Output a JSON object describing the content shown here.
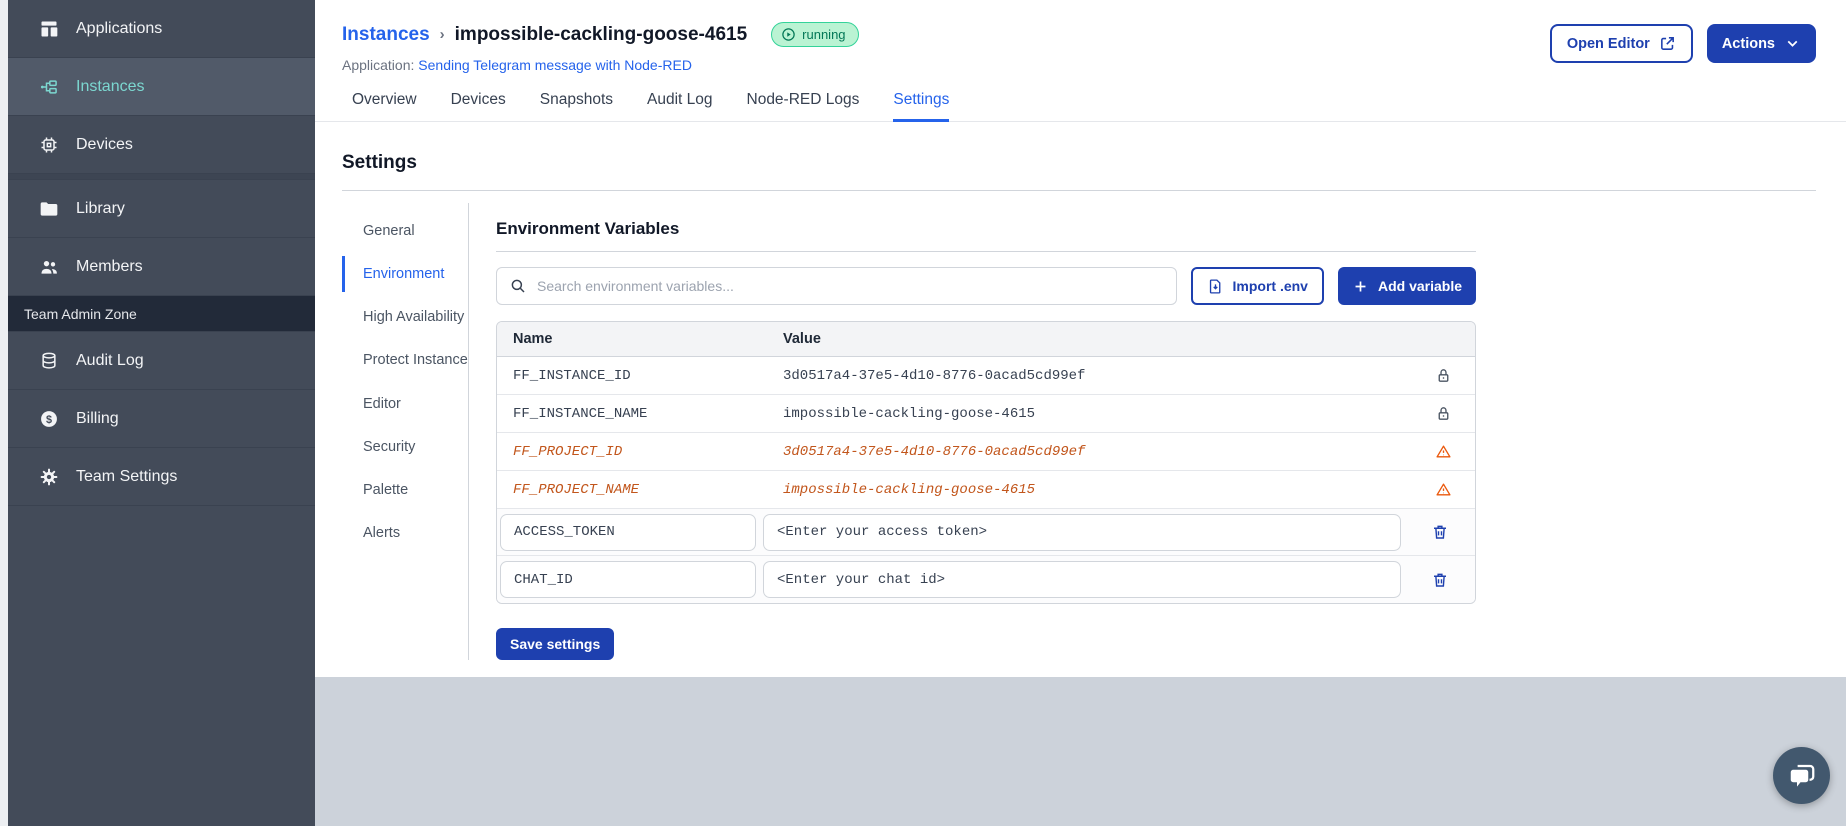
{
  "colors": {
    "primary_blue": "#1e40af",
    "link_blue": "#2563eb",
    "sidebar_bg": "#434b59",
    "sidebar_active_text": "#7cd7d0",
    "deprecated_orange": "#c2561c",
    "badge_green_bg": "#baf3d3",
    "badge_green_border": "#34d399",
    "badge_green_text": "#047857",
    "page_gray": "#ccd2da"
  },
  "sidebar": {
    "items": [
      {
        "label": "Applications"
      },
      {
        "label": "Instances"
      },
      {
        "label": "Devices"
      },
      {
        "label": "Library"
      },
      {
        "label": "Members"
      }
    ],
    "active_item": "Instances",
    "admin_zone_label": "Team Admin Zone",
    "admin_items": [
      {
        "label": "Audit Log"
      },
      {
        "label": "Billing"
      },
      {
        "label": "Team Settings"
      }
    ]
  },
  "header": {
    "breadcrumb_root": "Instances",
    "separator": "›",
    "instance_name": "impossible-cackling-goose-4615",
    "status": "running",
    "application_label": "Application:",
    "application_name": "Sending Telegram message with Node-RED",
    "open_editor": "Open Editor",
    "actions": "Actions"
  },
  "tabs": {
    "items": [
      {
        "label": "Overview"
      },
      {
        "label": "Devices"
      },
      {
        "label": "Snapshots"
      },
      {
        "label": "Audit Log"
      },
      {
        "label": "Node-RED Logs"
      },
      {
        "label": "Settings"
      }
    ],
    "active": "Settings"
  },
  "settings": {
    "title": "Settings",
    "nav": [
      {
        "label": "General"
      },
      {
        "label": "Environment"
      },
      {
        "label": "High Availability"
      },
      {
        "label": "Protect Instance"
      },
      {
        "label": "Editor"
      },
      {
        "label": "Security"
      },
      {
        "label": "Palette"
      },
      {
        "label": "Alerts"
      }
    ],
    "active_nav": "Environment",
    "section_title": "Environment Variables",
    "search_placeholder": "Search environment variables...",
    "import_button": "Import .env",
    "add_button": "Add variable",
    "table": {
      "name_header": "Name",
      "value_header": "Value",
      "locked_rows": [
        {
          "name": "FF_INSTANCE_ID",
          "value": "3d0517a4-37e5-4d10-8776-0acad5cd99ef"
        },
        {
          "name": "FF_INSTANCE_NAME",
          "value": "impossible-cackling-goose-4615"
        }
      ],
      "deprecated_rows": [
        {
          "name": "FF_PROJECT_ID",
          "value": "3d0517a4-37e5-4d10-8776-0acad5cd99ef"
        },
        {
          "name": "FF_PROJECT_NAME",
          "value": "impossible-cackling-goose-4615"
        }
      ],
      "editable_rows": [
        {
          "name": "ACCESS_TOKEN",
          "value": "<Enter your access token>"
        },
        {
          "name": "CHAT_ID",
          "value": "<Enter your chat id>"
        }
      ]
    },
    "save_button": "Save settings"
  }
}
